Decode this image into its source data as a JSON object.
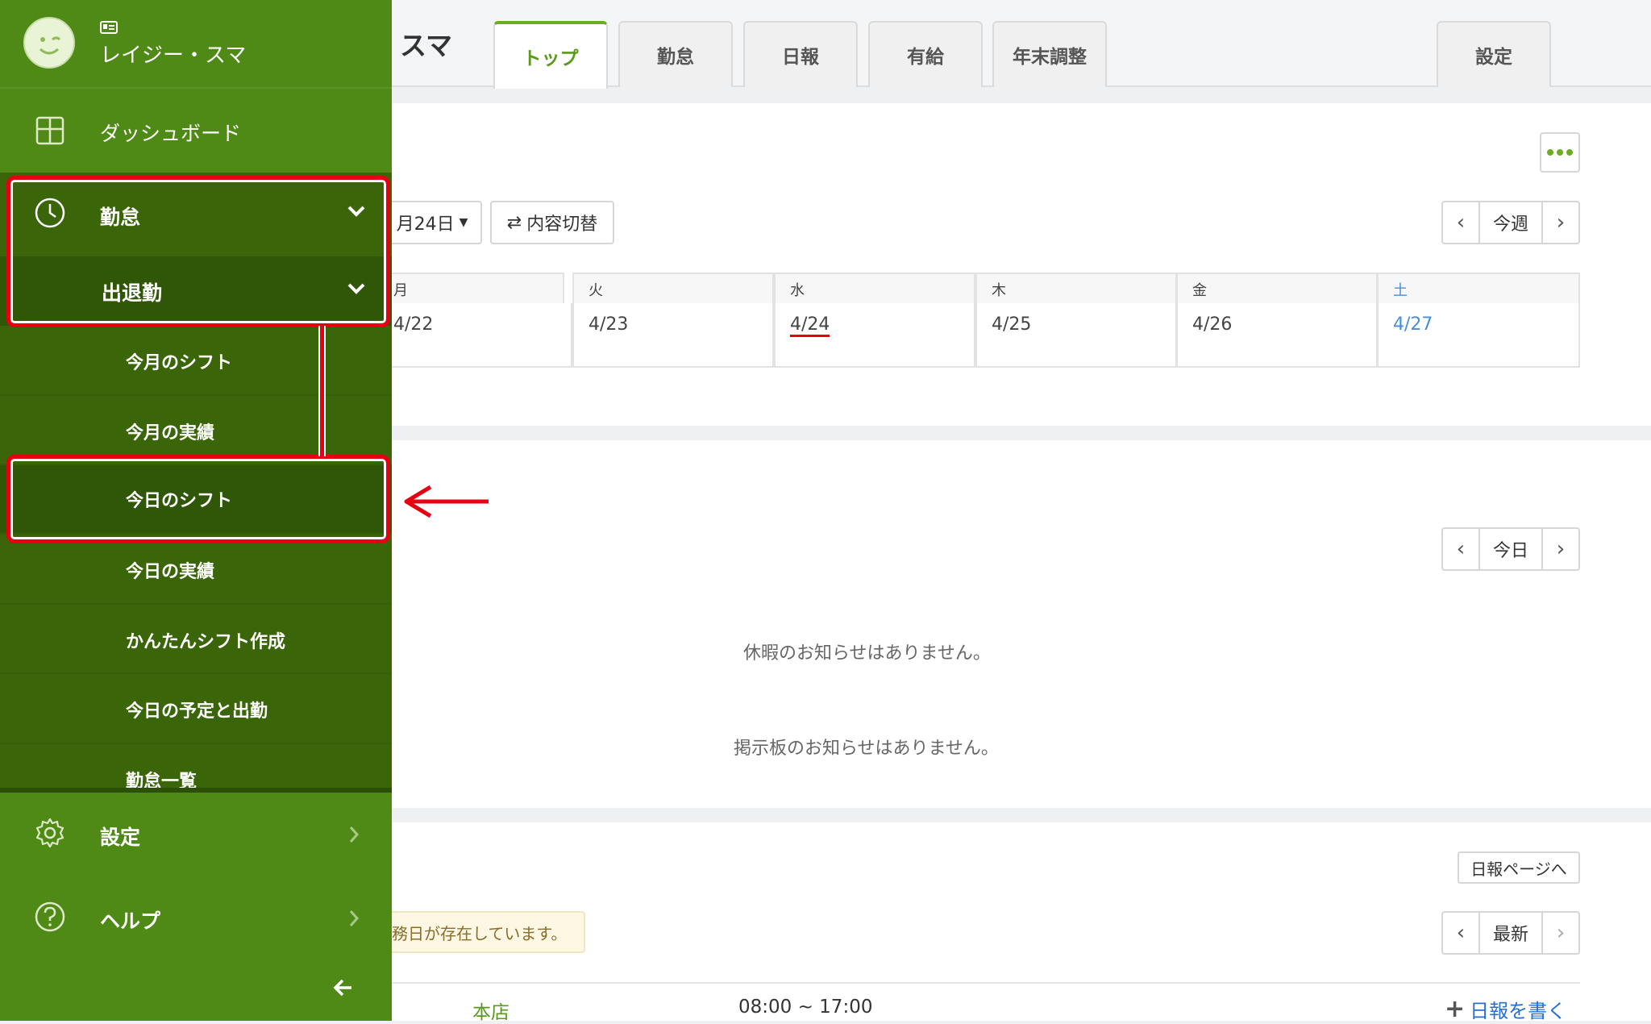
{
  "user": {
    "name": "レイジー・スマ",
    "header_name": "スマ"
  },
  "tabs": [
    {
      "label": "トップ",
      "active": true
    },
    {
      "label": "勤怠",
      "active": false
    },
    {
      "label": "日報",
      "active": false
    },
    {
      "label": "有給",
      "active": false
    },
    {
      "label": "年末調整",
      "active": false
    },
    {
      "label": "設定",
      "active": false
    }
  ],
  "sidebar": {
    "dashboard": "ダッシュボード",
    "attendance": "勤怠",
    "clock_in_out": "出退勤",
    "sub_items": [
      "今月のシフト",
      "今月の実績",
      "今日のシフト",
      "今日の実績",
      "かんたんシフト作成",
      "今日の予定と出勤",
      "勤怠一覧"
    ],
    "settings": "設定",
    "help": "ヘルプ"
  },
  "schedule": {
    "date_select": "月24日",
    "switch_label": "内容切替",
    "pager_label": "今週",
    "weekdays": [
      "月",
      "火",
      "水",
      "木",
      "金",
      "土"
    ],
    "dates": [
      "4/22",
      "4/23",
      "4/24",
      "4/25",
      "4/26",
      "4/27"
    ]
  },
  "notices": {
    "pager_label": "今日",
    "leave": "休暇のお知らせはありません。",
    "board": "掲示板のお知らせはありません。"
  },
  "daily_report": {
    "page_link": "日報ページへ",
    "pager_label": "最新",
    "warning": "務日が存在しています。",
    "store": "本店",
    "time": "08:00 ~ 17:00",
    "write_link": "日報を書く"
  },
  "colors": {
    "sidebar_dark": "#3d6b0b",
    "sidebar_light": "#4f8a17",
    "accent": "#6aae1f",
    "highlight": "#e60012",
    "saturday": "#4a8ed6"
  }
}
